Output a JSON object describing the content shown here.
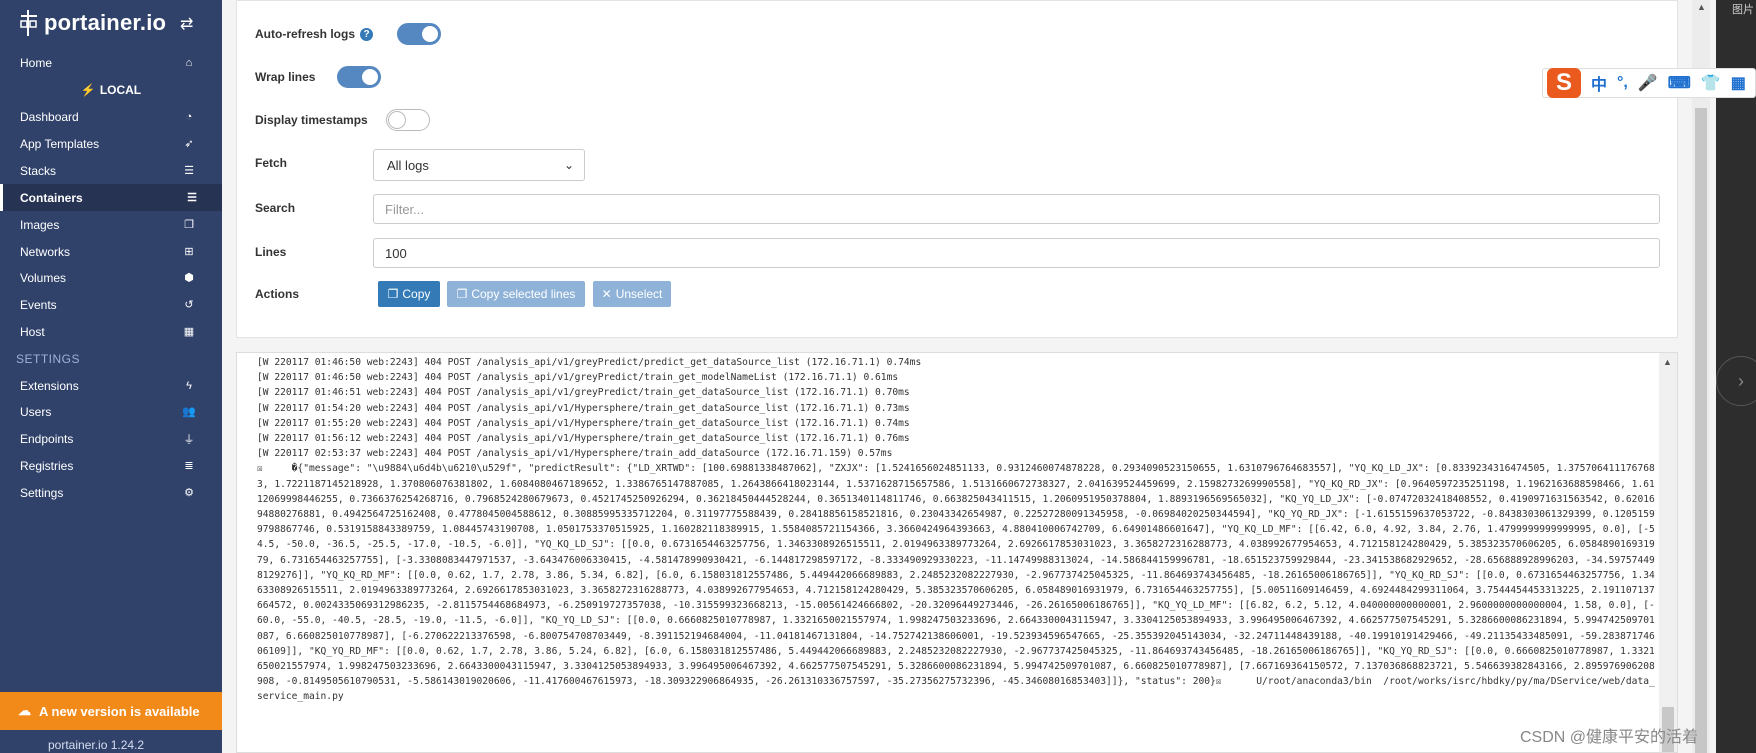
{
  "sidebar": {
    "brand": "portainer.io",
    "items_top": [
      {
        "label": "Home",
        "icon": "home-icon"
      }
    ],
    "endpoint_name": "LOCAL",
    "items_endpoint": [
      {
        "label": "Dashboard",
        "icon": "dashboard-icon"
      },
      {
        "label": "App Templates",
        "icon": "rocket-icon"
      },
      {
        "label": "Stacks",
        "icon": "list-icon"
      },
      {
        "label": "Containers",
        "icon": "list-icon"
      },
      {
        "label": "Images",
        "icon": "clone-icon"
      },
      {
        "label": "Networks",
        "icon": "sitemap-icon"
      },
      {
        "label": "Volumes",
        "icon": "cubes-icon"
      },
      {
        "label": "Events",
        "icon": "history-icon"
      },
      {
        "label": "Host",
        "icon": "grid-icon"
      }
    ],
    "settings_heading": "SETTINGS",
    "items_settings": [
      {
        "label": "Extensions",
        "icon": "bolt-icon"
      },
      {
        "label": "Users",
        "icon": "users-icon"
      },
      {
        "label": "Endpoints",
        "icon": "plug-icon"
      },
      {
        "label": "Registries",
        "icon": "database-icon"
      },
      {
        "label": "Settings",
        "icon": "cogs-icon"
      }
    ],
    "active_item": "Containers",
    "update_banner": "A new version is available",
    "footer": "portainer.io  1.24.2"
  },
  "log_settings": {
    "auto_refresh_label": "Auto-refresh logs",
    "auto_refresh_on": true,
    "wrap_lines_label": "Wrap lines",
    "wrap_lines_on": true,
    "display_timestamps_label": "Display timestamps",
    "display_timestamps_on": false,
    "fetch_label": "Fetch",
    "fetch_value": "All logs",
    "search_label": "Search",
    "search_placeholder": "Filter...",
    "lines_label": "Lines",
    "lines_value": "100",
    "actions_label": "Actions",
    "copy_button": "Copy",
    "copy_selected_button": "Copy selected lines",
    "unselect_button": "Unselect"
  },
  "logs": [
    "[W 220117 01:46:50 web:2243] 404 POST /analysis_api/v1/greyPredict/predict_get_dataSource_list (172.16.71.1) 0.74ms",
    "[W 220117 01:46:50 web:2243] 404 POST /analysis_api/v1/greyPredict/train_get_modelNameList (172.16.71.1) 0.61ms",
    "[W 220117 01:46:51 web:2243] 404 POST /analysis_api/v1/greyPredict/train_get_dataSource_list (172.16.71.1) 0.70ms",
    "[W 220117 01:54:20 web:2243] 404 POST /analysis_api/v1/Hypersphere/train_get_dataSource_list (172.16.71.1) 0.73ms",
    "[W 220117 01:55:20 web:2243] 404 POST /analysis_api/v1/Hypersphere/train_get_dataSource_list (172.16.71.1) 0.74ms",
    "[W 220117 01:56:12 web:2243] 404 POST /analysis_api/v1/Hypersphere/train_get_dataSource_list (172.16.71.1) 0.76ms",
    "[W 220117 02:53:37 web:2243] 404 POST /analysis_api/v1/Hypersphere/train_add_dataSource (172.16.71.159) 0.57ms",
    "☒     �{\"message\": \"\\u9884\\u6d4b\\u6210\\u529f\", \"predictResult\": {\"LD_XRTWD\": [100.69881338487062], \"ZXJX\": [1.5241656024851133, 0.9312460074878228, 0.2934090523150655, 1.6310796764683557], \"YQ_KQ_LD_JX\": [0.8339234316474505, 1.3757064111767683, 1.7221187145218928, 1.370806076381802, 1.6084080467189652, 1.3386765147887085, 1.2643866418023144, 1.5371628715657586, 1.5131660672738327, 2.041639524459699, 2.1598273269990558], \"YQ_KQ_RD_JX\": [0.9640597235251198, 1.1962163688598466, 1.6112069998446255, 0.7366376254268716, 0.7968524280679673, 0.4521745250926294, 0.36218450444528244, 0.3651340114811746, 0.663825043411515, 1.2060951950378804, 1.8893196569565032], \"KQ_YQ_LD_JX\": [-0.07472032418408552, 0.4190971631563542, 0.6201694880276881, 0.4942564725162408, 0.4778045004588612, 0.30885995335712204, 0.31197775588439, 0.28418856158521816, 0.23043342654987, 0.22527280091345958, -0.06984020250344594], \"KQ_YQ_RD_JX\": [-1.6155159637053722, -0.8438303061329399, 0.12051599798867746, 0.5319158843389759, 1.08445743190708, 1.0501753370515925, 1.160282118389915, 1.5584085721154366, 3.3660424964393663, 4.880410006742709, 6.64901486601647], \"YQ_KQ_LD_MF\": [[6.42, 6.0, 4.92, 3.84, 2.76, 1.4799999999999995, 0.0], [-54.5, -50.0, -36.5, -25.5, -17.0, -10.5, -6.0]], \"YQ_KQ_LD_SJ\": [[0.0, 0.6731654463257756, 1.3463308926515511, 2.0194963389773264, 2.6926617853031023, 3.3658272316288773, 4.038992677954653, 4.712158124280429, 5.385323570606205, 6.058489016931979, 6.731654463257755], [-3.3308083447971537, -3.643476006330415, -4.581478990930421, -6.144817298597172, -8.333490929330223, -11.14749988313024, -14.586844159996781, -18.651523759929844, -23.341538682929652, -28.656888928996203, -34.597574498129276]], \"YQ_KQ_RD_MF\": [[0.0, 0.62, 1.7, 2.78, 3.86, 5.34, 6.82], [6.0, 6.158031812557486, 5.449442066689883, 2.2485232082227930, -2.967737425045325, -11.864693743456485, -18.26165006186765]], \"YQ_KQ_RD_SJ\": [[0.0, 0.6731654463257756, 1.3463308926515511, 2.0194963389773264, 2.6926617853031023, 3.3658272316288773, 4.038992677954653, 4.712158124280429, 5.385323570606205, 6.058489016931979, 6.731654463257755], [5.00511609146459, 4.6924484299311064, 3.7544454453313225, 2.191107137664572, 0.0024335069312986235, -2.811575446868497​3, -6.250919727357038, -10.315599323668213, -15.0056142466680​2, -20.32096449273446, -26.26165006186765]], \"KQ_YQ_LD_MF\": [[6.82, 6.2, 5.12, 4.040000000000001, 2.9600000000000004, 1.58, 0.0], [-60.0, -55.0, -40.5, -28.5, -19.0, -11.5, -6.0]], \"KQ_YQ_LD_SJ\": [[0.0, 0.6660825010778987, 1.3321650021557974, 1.998247503233696, 2.6643300043115947, 3.3304125053894933, 3.996495006467392, 4.662577507545291, 5.3286600086231894, 5.994742509701087, 6.660825010778987], [-6.270622213376598, -6.800754708703449, -8.391152194684004, -11.04181467131804, -14.752742138606001, -19.523934596547665, -25.355392045143034, -32.24711448439188, -40.19910191429466, -49.21135433485091, -59.28387174606109]], \"KQ_YQ_RD_MF\": [[0.0, 0.62, 1.7, 2.78, 3.86, 5.24, 6.82], [6.0, 6.158031812557486, 5.449442066689883, 2.2485232082227930, -2.967737425045325, -11.864693743456485, -18.26165006186765]], \"KQ_YQ_RD_SJ\": [[0.0, 0.6660825010778987, 1.3321650021557974, 1.998247503233696, 2.6643300043115947, 3.3304125053894933, 3.996495006467392, 4.662577507545291, 5.3286600086231894, 5.994742509701087, 6.660825010778987], [7.667169364150572, 7.137036868823721, 5.546639382843166, 2.895976906208908, -0.8149505610790531, -5.586143019020606, -11.417600467615973, -18.309322906864935, -26.261310336757597, -35.27356275732396, -45.34608016853403]]}, \"status\": 200}☒      U/root/anaconda3/bin  /root/works/isrc/hbdky/py/ma/DService/web/data_service_main.py"
  ],
  "ime_toolbar": {
    "s_label": "S",
    "items": [
      "中",
      "°,"
    ]
  },
  "corner_text": "图片",
  "watermark": "CSDN @健康平安的活着"
}
